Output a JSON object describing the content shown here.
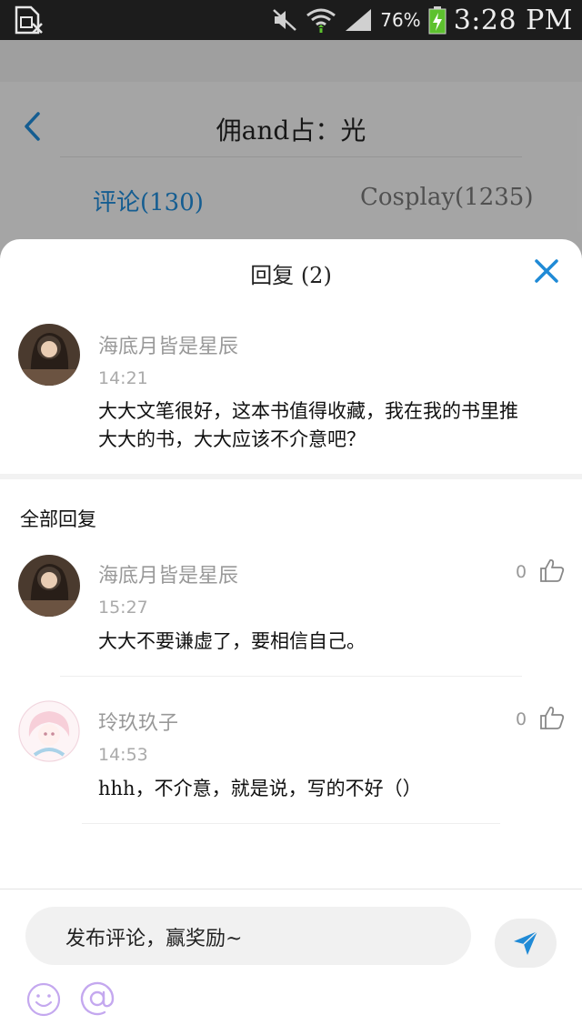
{
  "status_bar": {
    "battery_percent": "76%",
    "time": "3:28 PM"
  },
  "background_page": {
    "title": "佣and占：光",
    "tabs": [
      {
        "label": "评论(130)",
        "active": true
      },
      {
        "label": "Cosplay(1235)",
        "active": false
      }
    ]
  },
  "sheet": {
    "title": "回复 (2)",
    "original_comment": {
      "username": "海底月皆是星辰",
      "time": "14:21",
      "text_lines": [
        "大大文笔很好，这本书值得收藏，我在我的书里推",
        "大大的书，大大应该不介意吧？"
      ]
    },
    "section_label": "全部回复",
    "replies": [
      {
        "username": "海底月皆是星辰",
        "time": "15:27",
        "text": "大大不要谦虚了，要相信自己。",
        "likes": "0"
      },
      {
        "username": "玲玖玖子",
        "time": "14:53",
        "text": "hhh，不介意，就是说，写的不好（）",
        "likes": "0"
      }
    ],
    "composer": {
      "placeholder": "发布评论，赢奖励~"
    }
  },
  "colors": {
    "accent": "#1f8ad6",
    "icon_purple": "#c4a8ef",
    "status_bar": "#1c1c1c"
  },
  "icons": [
    "sim-icon",
    "mute-icon",
    "wifi-icon",
    "signal-icon",
    "battery-icon",
    "back-arrow-icon",
    "close-icon",
    "thumbs-up-icon",
    "send-icon",
    "emoji-icon",
    "at-icon"
  ]
}
